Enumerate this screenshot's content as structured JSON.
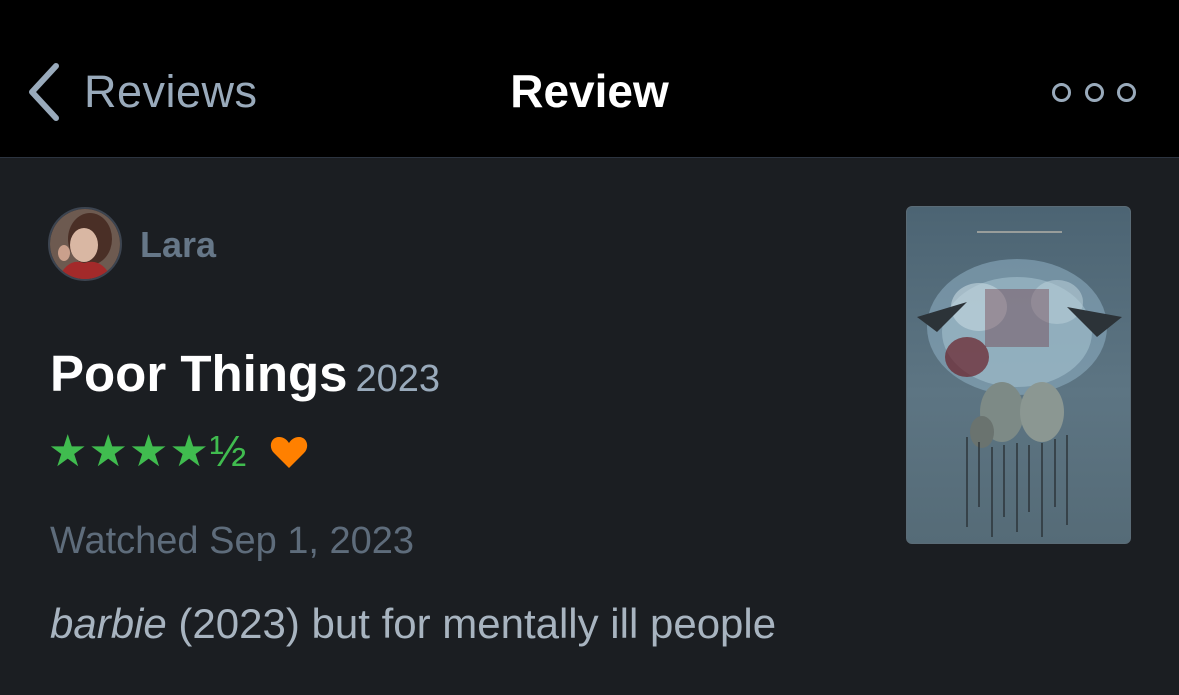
{
  "nav": {
    "back_label": "Reviews",
    "title": "Review",
    "back_icon": "chevron-left-icon",
    "more_icon": "ellipsis-icon"
  },
  "review": {
    "user_name": "Lara",
    "film_title": "Poor Things",
    "film_year": "2023",
    "rating_display": "★★★★½",
    "rating_value": 4.5,
    "rating_max": 5,
    "liked": true,
    "watched_text": "Watched Sep 1, 2023",
    "review_text_italic": "barbie",
    "review_text_rest": " (2023) but for mentally ill people"
  },
  "colors": {
    "nav_background": "#000000",
    "content_background": "#1b1e22",
    "star_green": "#40bc4f",
    "heart_orange": "#ff8000",
    "muted_text": "#99aabb"
  }
}
